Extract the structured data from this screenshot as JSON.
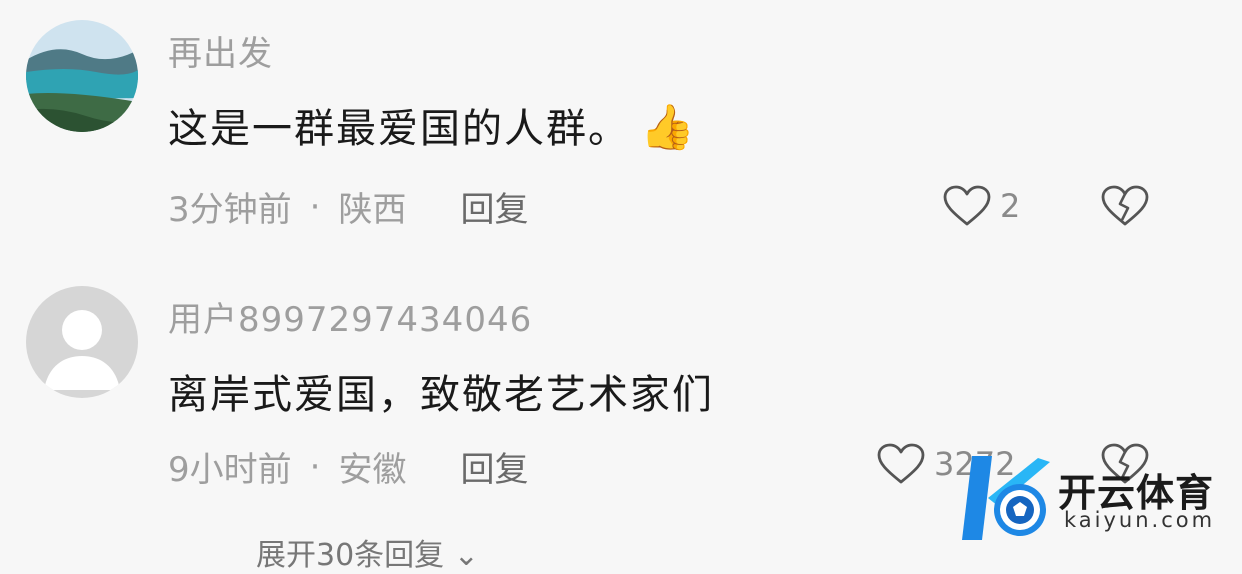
{
  "comments": [
    {
      "username": "再出发",
      "text": "这是一群最爱国的人群。",
      "emoji": "👍",
      "time": "3分钟前",
      "location": "陕西",
      "separator": "·",
      "reply_label": "回复",
      "like_count": "2",
      "avatar_icon": "lake-landscape-avatar"
    },
    {
      "username": "用户8997297434046",
      "text": "离岸式爱国，致敬老艺术家们",
      "time": "9小时前",
      "location": "安徽",
      "separator": "·",
      "reply_label": "回复",
      "like_count": "3272",
      "avatar_icon": "default-user-avatar"
    }
  ],
  "expand_label": "展开30条回复 ⌄",
  "watermark": {
    "title": "开云体育",
    "url": "kaiyun.com"
  },
  "colors": {
    "accent_blue": "#1e88e5",
    "text_primary": "#1a1a1a",
    "text_secondary": "#9e9e9e"
  }
}
